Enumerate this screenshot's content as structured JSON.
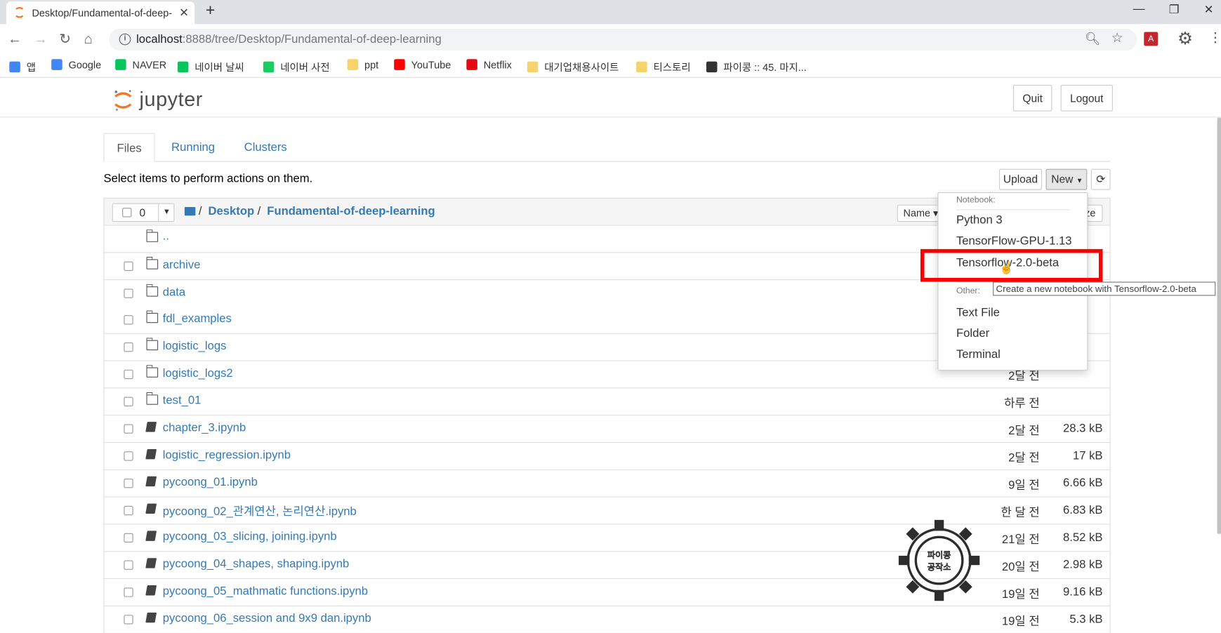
{
  "browser": {
    "tab_title": "Desktop/Fundamental-of-deep-",
    "url_host": "localhost",
    "url_rest": ":8888/tree/Desktop/Fundamental-of-deep-learning",
    "bookmarks": [
      {
        "label": "앱",
        "color": "#4285f4"
      },
      {
        "label": "Google",
        "color": "#4285f4"
      },
      {
        "label": "NAVER",
        "color": "#03c75a"
      },
      {
        "label": "네이버 날씨",
        "color": "#03c75a"
      },
      {
        "label": "네이버 사전",
        "color": "#19ce60"
      },
      {
        "label": "ppt",
        "color": "#f6d36b"
      },
      {
        "label": "YouTube",
        "color": "#ff0000"
      },
      {
        "label": "Netflix",
        "color": "#e50914"
      },
      {
        "label": "대기업채용사이트",
        "color": "#f6d36b"
      },
      {
        "label": "티스토리",
        "color": "#f6d36b"
      },
      {
        "label": "파이콩 :: 45. 마지...",
        "color": "#333333"
      }
    ]
  },
  "jupyter": {
    "logo_text": "jupyter",
    "quit_label": "Quit",
    "logout_label": "Logout",
    "tabs": [
      "Files",
      "Running",
      "Clusters"
    ],
    "hint": "Select items to perform actions on them.",
    "upload_label": "Upload",
    "new_label": "New",
    "selected_count": "0",
    "breadcrumb": [
      "Desktop",
      "Fundamental-of-deep-learning"
    ],
    "sort_name_label": "Name",
    "sort_size_label": "ze",
    "parent_dir": "..",
    "files": [
      {
        "name": "archive",
        "type": "folder",
        "modified": "",
        "size": ""
      },
      {
        "name": "data",
        "type": "folder",
        "modified": "",
        "size": ""
      },
      {
        "name": "fdl_examples",
        "type": "folder",
        "modified": "",
        "size": ""
      },
      {
        "name": "logistic_logs",
        "type": "folder",
        "modified": "",
        "size": ""
      },
      {
        "name": "logistic_logs2",
        "type": "folder",
        "modified": "2달 전",
        "size": ""
      },
      {
        "name": "test_01",
        "type": "folder",
        "modified": "하루 전",
        "size": ""
      },
      {
        "name": "chapter_3.ipynb",
        "type": "notebook",
        "modified": "2달 전",
        "size": "28.3 kB"
      },
      {
        "name": "logistic_regression.ipynb",
        "type": "notebook",
        "modified": "2달 전",
        "size": "17 kB"
      },
      {
        "name": "pycoong_01.ipynb",
        "type": "notebook",
        "modified": "9일 전",
        "size": "6.66 kB"
      },
      {
        "name": "pycoong_02_관계연산, 논리연산.ipynb",
        "type": "notebook",
        "modified": "한 달 전",
        "size": "6.83 kB"
      },
      {
        "name": "pycoong_03_slicing, joining.ipynb",
        "type": "notebook",
        "modified": "21일 전",
        "size": "8.52 kB"
      },
      {
        "name": "pycoong_04_shapes, shaping.ipynb",
        "type": "notebook",
        "modified": "20일 전",
        "size": "2.98 kB"
      },
      {
        "name": "pycoong_05_mathmatic functions.ipynb",
        "type": "notebook",
        "modified": "19일 전",
        "size": "9.16 kB"
      },
      {
        "name": "pycoong_06_session and 9x9 dan.ipynb",
        "type": "notebook",
        "modified": "19일 전",
        "size": "5.3 kB"
      }
    ],
    "new_menu": {
      "notebook_header": "Notebook:",
      "kernels": [
        "Python 3",
        "TensorFlow-GPU-1.13",
        "Tensorflow-2.0-beta"
      ],
      "other_header": "Other:",
      "others": [
        "Text File",
        "Folder",
        "Terminal"
      ],
      "tooltip": "Create a new notebook with Tensorflow-2.0-beta"
    },
    "watermark_text": [
      "파이콩",
      "공작소"
    ]
  }
}
